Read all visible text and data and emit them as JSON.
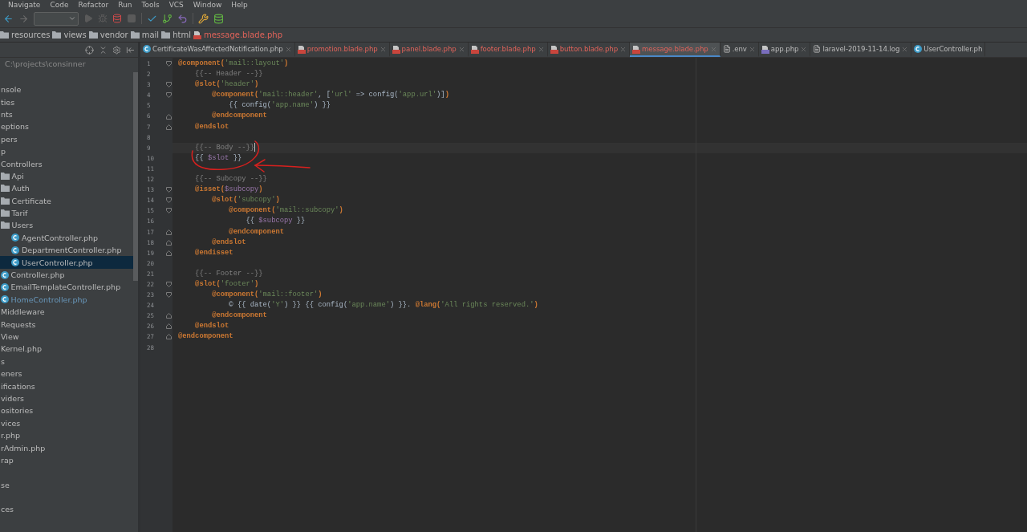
{
  "menu": [
    "Navigate",
    "Code",
    "Refactor",
    "Run",
    "Tools",
    "VCS",
    "Window",
    "Help"
  ],
  "breadcrumbs": [
    {
      "label": "resources",
      "kind": "folder"
    },
    {
      "label": "views",
      "kind": "folder"
    },
    {
      "label": "vendor",
      "kind": "folder"
    },
    {
      "label": "mail",
      "kind": "folder"
    },
    {
      "label": "html",
      "kind": "folder"
    },
    {
      "label": "message.blade.php",
      "kind": "blade"
    }
  ],
  "project": {
    "path": "C:\\projects\\consinner",
    "tree": [
      {
        "label": "nsole"
      },
      {
        "label": "ties"
      },
      {
        "label": "nts"
      },
      {
        "label": "eptions"
      },
      {
        "label": "pers"
      },
      {
        "label": "p"
      },
      {
        "label": "Controllers",
        "children": [
          {
            "label": "Api",
            "kind": "folder"
          },
          {
            "label": "Auth",
            "kind": "folder"
          },
          {
            "label": "Certificate",
            "kind": "folder"
          },
          {
            "label": "Tarif",
            "kind": "folder"
          },
          {
            "label": "Users",
            "kind": "folder",
            "children": [
              {
                "label": "AgentController.php",
                "kind": "class",
                "selected": false
              },
              {
                "label": "DepartmentController.php",
                "kind": "class",
                "selected": false
              },
              {
                "label": "UserController.php",
                "kind": "class",
                "selected": true
              }
            ]
          },
          {
            "label": "Controller.php",
            "kind": "class",
            "modified": false
          },
          {
            "label": "EmailTemplateController.php",
            "kind": "class",
            "modified": false
          },
          {
            "label": "HomeController.php",
            "kind": "class",
            "modified": true
          }
        ]
      },
      {
        "label": "Middleware"
      },
      {
        "label": "Requests"
      },
      {
        "label": "View"
      },
      {
        "label": "Kernel.php"
      },
      {
        "label": "s"
      },
      {
        "label": "eners"
      },
      {
        "label": "ifications"
      },
      {
        "label": "viders"
      },
      {
        "label": "ositories"
      },
      {
        "label": "vices"
      },
      {
        "label": "r.php"
      },
      {
        "label": "rAdmin.php"
      },
      {
        "label": "rap"
      },
      {
        "label": "se",
        "gap_before": true
      },
      {
        "label": "ces",
        "gap_before": true
      }
    ]
  },
  "tabs": [
    {
      "label": "CertificateWasAffectedNotification.php",
      "kind": "class",
      "selected": false
    },
    {
      "label": "promotion.blade.php",
      "kind": "blade",
      "selected": false
    },
    {
      "label": "panel.blade.php",
      "kind": "blade",
      "selected": false
    },
    {
      "label": "footer.blade.php",
      "kind": "blade",
      "selected": false
    },
    {
      "label": "button.blade.php",
      "kind": "blade",
      "selected": false
    },
    {
      "label": "message.blade.php",
      "kind": "blade",
      "selected": true
    },
    {
      "label": ".env",
      "kind": "text",
      "selected": false
    },
    {
      "label": "app.php",
      "kind": "php",
      "selected": false
    },
    {
      "label": "laravel-2019-11-14.log",
      "kind": "text",
      "selected": false
    },
    {
      "label": "UserController.ph",
      "kind": "class",
      "selected": false
    }
  ],
  "code": [
    {
      "number": "1",
      "fold_start": true,
      "tokens": [
        {
          "kind": "dir",
          "text": "@component("
        },
        {
          "kind": "str",
          "text": "'mail::layout'"
        },
        {
          "kind": "dir",
          "text": ")"
        }
      ]
    },
    {
      "number": "2",
      "tokens": [
        {
          "kind": "cmt",
          "text": "    {{-- Header --}}"
        }
      ]
    },
    {
      "number": "3",
      "fold_start": true,
      "tokens": [
        {
          "kind": "dir",
          "text": "    @slot("
        },
        {
          "kind": "str",
          "text": "'header'"
        },
        {
          "kind": "dir",
          "text": ")"
        }
      ]
    },
    {
      "number": "4",
      "fold_start": true,
      "tokens": [
        {
          "kind": "dir",
          "text": "        @component("
        },
        {
          "kind": "str",
          "text": "'mail::header'"
        },
        {
          "kind": "plain",
          "text": ", ["
        },
        {
          "kind": "str",
          "text": "'url'"
        },
        {
          "kind": "plain",
          "text": " => config("
        },
        {
          "kind": "str",
          "text": "'app.url'"
        },
        {
          "kind": "plain",
          "text": ")]"
        },
        {
          "kind": "dir",
          "text": ")"
        }
      ]
    },
    {
      "number": "5",
      "tokens": [
        {
          "kind": "plain",
          "text": "            {{ config("
        },
        {
          "kind": "str",
          "text": "'app.name'"
        },
        {
          "kind": "plain",
          "text": ") }}"
        }
      ]
    },
    {
      "number": "6",
      "fold_end": true,
      "tokens": [
        {
          "kind": "dir",
          "text": "        @endcomponent"
        }
      ]
    },
    {
      "number": "7",
      "fold_end": true,
      "tokens": [
        {
          "kind": "dir",
          "text": "    @endslot"
        }
      ]
    },
    {
      "number": "8"
    },
    {
      "number": "9",
      "current": true,
      "tokens": [
        {
          "kind": "cmt",
          "text": "    {{-- Body --}}"
        }
      ]
    },
    {
      "number": "10",
      "tokens": [
        {
          "kind": "plain",
          "text": "    {{ "
        },
        {
          "kind": "var",
          "text": "$slot"
        },
        {
          "kind": "plain",
          "text": " }}"
        }
      ]
    },
    {
      "number": "11"
    },
    {
      "number": "12",
      "tokens": [
        {
          "kind": "cmt",
          "text": "    {{-- Subcopy --}}"
        }
      ]
    },
    {
      "number": "13",
      "fold_start": true,
      "tokens": [
        {
          "kind": "dir",
          "text": "    @isset("
        },
        {
          "kind": "var",
          "text": "$subcopy"
        },
        {
          "kind": "dir",
          "text": ")"
        }
      ]
    },
    {
      "number": "14",
      "fold_start": true,
      "tokens": [
        {
          "kind": "dir",
          "text": "        @slot("
        },
        {
          "kind": "str",
          "text": "'subcopy'"
        },
        {
          "kind": "dir",
          "text": ")"
        }
      ]
    },
    {
      "number": "15",
      "fold_start": true,
      "tokens": [
        {
          "kind": "dir",
          "text": "            @component("
        },
        {
          "kind": "str",
          "text": "'mail::subcopy'"
        },
        {
          "kind": "dir",
          "text": ")"
        }
      ]
    },
    {
      "number": "16",
      "tokens": [
        {
          "kind": "plain",
          "text": "                {{ "
        },
        {
          "kind": "var",
          "text": "$subcopy"
        },
        {
          "kind": "plain",
          "text": " }}"
        }
      ]
    },
    {
      "number": "17",
      "fold_end": true,
      "tokens": [
        {
          "kind": "dir",
          "text": "            @endcomponent"
        }
      ]
    },
    {
      "number": "18",
      "fold_end": true,
      "tokens": [
        {
          "kind": "dir",
          "text": "        @endslot"
        }
      ]
    },
    {
      "number": "19",
      "fold_end": true,
      "tokens": [
        {
          "kind": "dir",
          "text": "    @endisset"
        }
      ]
    },
    {
      "number": "20"
    },
    {
      "number": "21",
      "tokens": [
        {
          "kind": "cmt",
          "text": "    {{-- Footer --}}"
        }
      ]
    },
    {
      "number": "22",
      "fold_start": true,
      "tokens": [
        {
          "kind": "dir",
          "text": "    @slot("
        },
        {
          "kind": "str",
          "text": "'footer'"
        },
        {
          "kind": "dir",
          "text": ")"
        }
      ]
    },
    {
      "number": "23",
      "fold_start": true,
      "tokens": [
        {
          "kind": "dir",
          "text": "        @component("
        },
        {
          "kind": "str",
          "text": "'mail::footer'"
        },
        {
          "kind": "dir",
          "text": ")"
        }
      ]
    },
    {
      "number": "24",
      "tokens": [
        {
          "kind": "plain",
          "text": "            © {{ date("
        },
        {
          "kind": "str",
          "text": "'Y'"
        },
        {
          "kind": "plain",
          "text": ") }} {{ config("
        },
        {
          "kind": "str",
          "text": "'app.name'"
        },
        {
          "kind": "plain",
          "text": ") }}. "
        },
        {
          "kind": "dir",
          "text": "@lang("
        },
        {
          "kind": "str",
          "text": "'All rights reserved.'"
        },
        {
          "kind": "dir",
          "text": ")"
        }
      ]
    },
    {
      "number": "25",
      "fold_end": true,
      "tokens": [
        {
          "kind": "dir",
          "text": "        @endcomponent"
        }
      ]
    },
    {
      "number": "26",
      "fold_end": true,
      "tokens": [
        {
          "kind": "dir",
          "text": "    @endslot"
        }
      ]
    },
    {
      "number": "27",
      "fold_end": true,
      "tokens": [
        {
          "kind": "dir",
          "text": "@endcomponent"
        }
      ]
    },
    {
      "number": "28"
    }
  ]
}
